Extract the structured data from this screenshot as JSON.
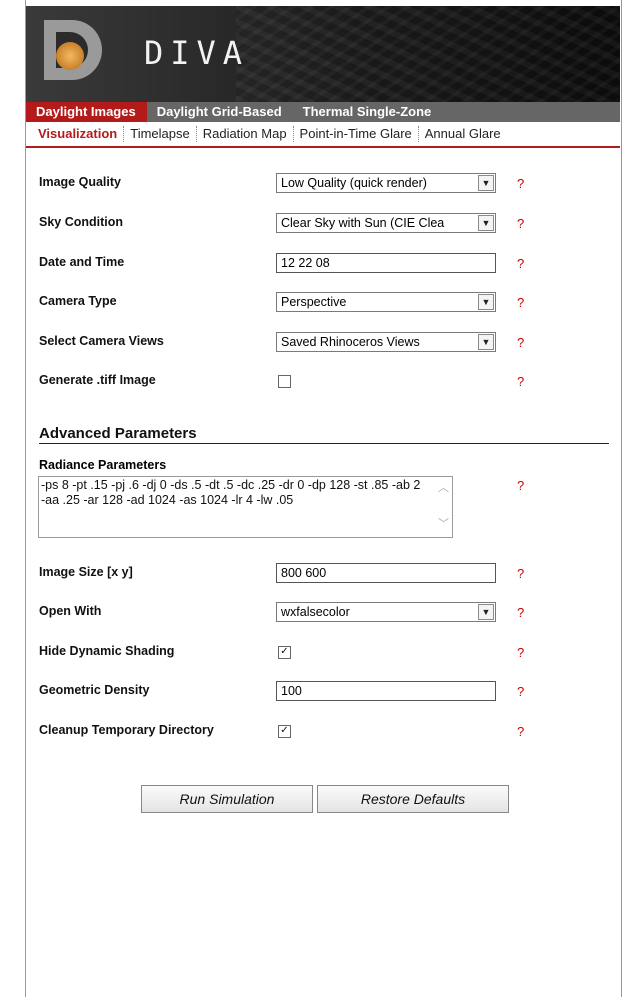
{
  "app": {
    "title": "DIVA"
  },
  "main_tabs": [
    {
      "label": "Daylight Images",
      "active": true
    },
    {
      "label": "Daylight Grid-Based",
      "active": false
    },
    {
      "label": "Thermal Single-Zone",
      "active": false
    }
  ],
  "sub_tabs": [
    {
      "label": "Visualization",
      "active": true
    },
    {
      "label": "Timelapse",
      "active": false
    },
    {
      "label": "Radiation Map",
      "active": false
    },
    {
      "label": "Point-in-Time Glare",
      "active": false
    },
    {
      "label": "Annual Glare",
      "active": false
    }
  ],
  "fields": {
    "image_quality": {
      "label": "Image Quality",
      "value": "Low Quality (quick render)"
    },
    "sky_condition": {
      "label": "Sky Condition",
      "value": "Clear Sky with Sun (CIE Clea"
    },
    "date_time": {
      "label": "Date and Time",
      "value": "12 22 08"
    },
    "camera_type": {
      "label": "Camera Type",
      "value": "Perspective"
    },
    "camera_views": {
      "label": "Select Camera Views",
      "value": "Saved Rhinoceros Views"
    },
    "generate_tiff": {
      "label": "Generate .tiff Image",
      "checked": false
    },
    "radiance": {
      "label": "Radiance Parameters",
      "value": "-ps 8 -pt .15 -pj .6 -dj 0 -ds .5 -dt .5 -dc .25 -dr 0 -dp 128 -st .85 -ab 2 -aa .25 -ar 128 -ad 1024 -as 1024 -lr 4 -lw .05"
    },
    "image_size": {
      "label": "Image Size [x y]",
      "value": "800 600"
    },
    "open_with": {
      "label": "Open With",
      "value": "wxfalsecolor"
    },
    "hide_shading": {
      "label": "Hide Dynamic Shading",
      "checked": true
    },
    "geo_density": {
      "label": "Geometric Density",
      "value": "100"
    },
    "cleanup": {
      "label": "Cleanup Temporary Directory",
      "checked": true
    }
  },
  "section": {
    "advanced": "Advanced Parameters"
  },
  "help_mark": "?",
  "buttons": {
    "run": "Run Simulation",
    "restore": "Restore Defaults"
  },
  "glyphs": {
    "check": "✓",
    "arrow_down": "▼",
    "scroll_up": "︿",
    "scroll_down": "﹀"
  },
  "colors": {
    "accent": "#b31b1b",
    "help": "#cc0000"
  }
}
